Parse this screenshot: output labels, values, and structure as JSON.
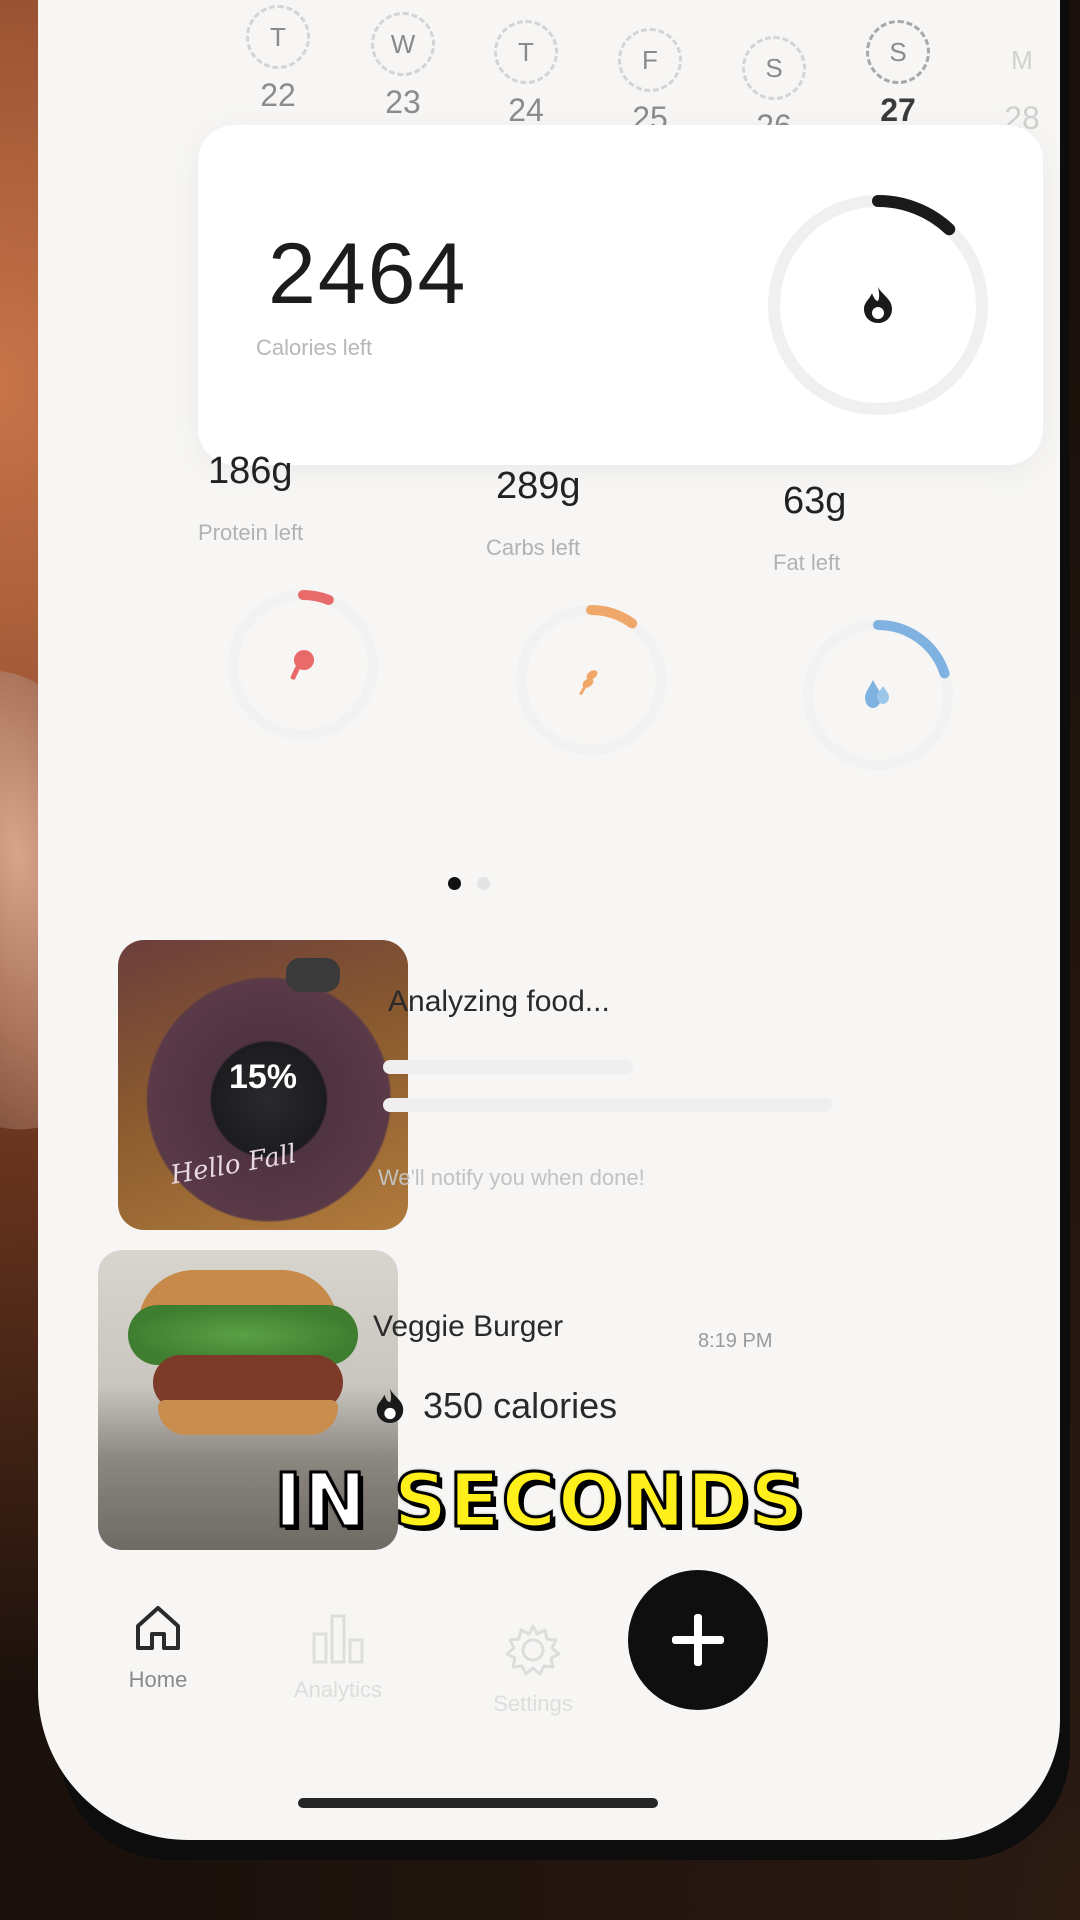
{
  "week": {
    "days": [
      {
        "letter": "T",
        "num": "22"
      },
      {
        "letter": "W",
        "num": "23"
      },
      {
        "letter": "T",
        "num": "24"
      },
      {
        "letter": "F",
        "num": "25"
      },
      {
        "letter": "S",
        "num": "26"
      },
      {
        "letter": "S",
        "num": "27"
      },
      {
        "letter": "M",
        "num": "28"
      }
    ],
    "selected": "27"
  },
  "calories": {
    "value": "2464",
    "label": "Calories left",
    "progress": 0.12
  },
  "macros": [
    {
      "value": "186g",
      "label": "Protein left",
      "color": "#e86a6a",
      "progress": 0.06,
      "icon": "drumstick-icon"
    },
    {
      "value": "289g",
      "label": "Carbs left",
      "color": "#f0a86a",
      "progress": 0.1,
      "icon": "wheat-icon"
    },
    {
      "value": "63g",
      "label": "Fat left",
      "color": "#7fb2e0",
      "progress": 0.2,
      "icon": "drop-icon"
    }
  ],
  "pager": {
    "active": 0,
    "count": 2
  },
  "analyzing": {
    "percent": "15%",
    "title": "Analyzing food...",
    "note": "We'll notify you when done!",
    "plate_script": "Hello Fall"
  },
  "entry": {
    "title": "Veggie Burger",
    "time": "8:19 PM",
    "calories": "350 calories"
  },
  "nav": {
    "home": "Home",
    "analytics": "Analytics",
    "settings": "Settings"
  },
  "caption": {
    "word1": "IN",
    "word2": "SECONDS"
  },
  "colors": {
    "accent": "#111111",
    "caption_highlight": "#ffef1a"
  }
}
